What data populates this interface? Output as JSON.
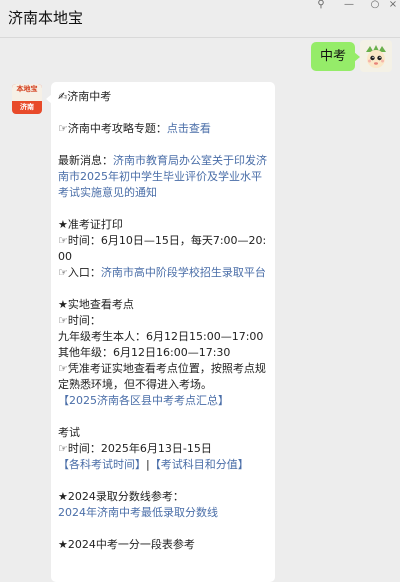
{
  "header": {
    "title": "济南本地宝"
  },
  "sent": {
    "text": "中考"
  },
  "bot": {
    "avatar_top": "本地宝",
    "avatar_bottom": "济南"
  },
  "message": {
    "heading": "✍济南中考",
    "topic_prefix": "☞济南中考攻略专题：",
    "topic_link": "点击查看",
    "news_prefix": "最新消息：",
    "news_link": "济南市教育局办公室关于印发济南市2025年初中学生毕业评价及学业水平考试实施意见的通知",
    "print_title": "★准考证打印",
    "print_time": "☞时间：6月10日—15日，每天7:00—20:00",
    "print_entry_prefix": "☞入口：",
    "print_entry_link": "济南市高中阶段学校招生录取平台",
    "site_title": "★实地查看考点",
    "site_time_label": "☞时间：",
    "site_line1": "九年级考生本人：6月12日15:00—17:00",
    "site_line2": "其他年级：6月12日16:00—17:30",
    "site_note": "☞凭准考证实地查看考点位置，按照考点规定熟悉环境，但不得进入考场。",
    "site_link": "【2025济南各区县中考考点汇总】",
    "exam_title": "考试",
    "exam_time": "☞时间：2025年6月13日-15日",
    "exam_link1": "【各科考试时间】",
    "exam_sep": "|",
    "exam_link2": "【考试科目和分值】",
    "score_title": "★2024录取分数线参考：",
    "score_link": "2024年济南中考最低录取分数线",
    "rank_title": "★2024中考一分一段表参考"
  }
}
